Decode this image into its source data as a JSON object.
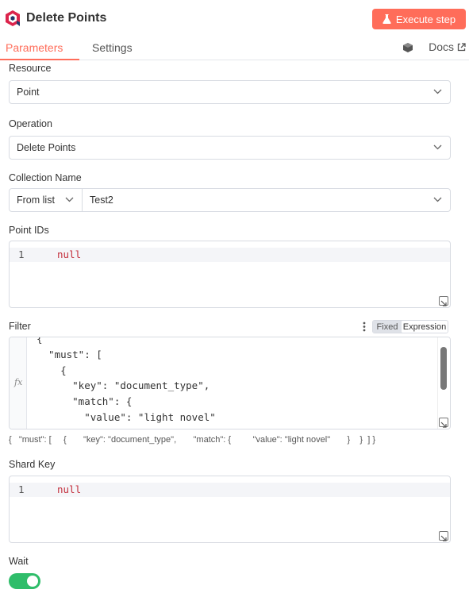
{
  "header": {
    "title": "Delete Points",
    "execute_label": "Execute step",
    "logo_icon": "qdrant-logo-icon",
    "accent_color": "#ff6d5a"
  },
  "tabs": {
    "parameters": "Parameters",
    "settings": "Settings",
    "docs": "Docs"
  },
  "fields": {
    "resource": {
      "label": "Resource",
      "value": "Point"
    },
    "operation": {
      "label": "Operation",
      "value": "Delete Points"
    },
    "collection": {
      "label": "Collection Name",
      "mode": "From list",
      "value": "Test2"
    },
    "point_ids": {
      "label": "Point IDs",
      "line_number": "1",
      "value": "null"
    },
    "filter": {
      "label": "Filter",
      "mode_fixed": "Fixed",
      "mode_expression": "Expression",
      "fx_label": "fx",
      "code": "{\n  \"must\": [\n    {\n      \"key\": \"document_type\",\n      \"match\": {\n        \"value\": \"light novel\"\n      }",
      "preview": "{   \"must\": [     {       \"key\": \"document_type\",       \"match\": {         \"value\": \"light novel\"       }    }  ] }"
    },
    "shard_key": {
      "label": "Shard Key",
      "line_number": "1",
      "value": "null"
    },
    "wait": {
      "label": "Wait",
      "enabled": true
    }
  },
  "colors": {
    "null_text": "#c4303d",
    "toggle_on": "#2fbd6a"
  }
}
